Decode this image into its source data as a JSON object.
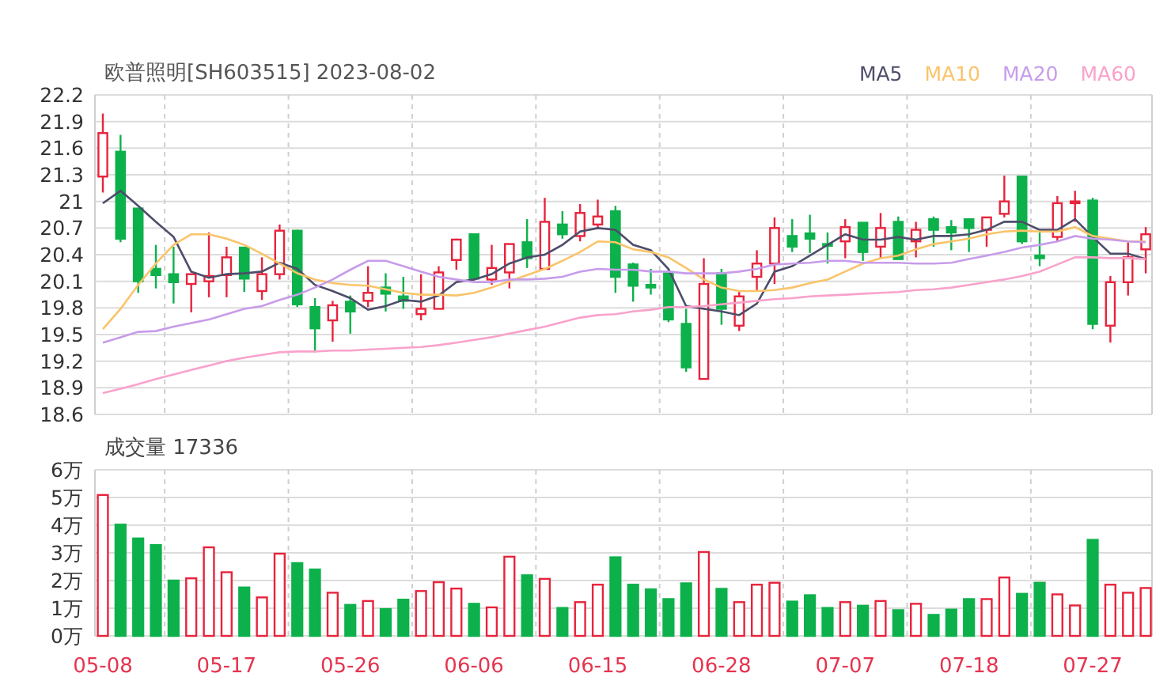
{
  "title": "欧普照明[SH603515] 2023-08-02",
  "price_chart": {
    "chart_data": {
      "type": "candlestick",
      "grid": true,
      "ylim": [
        18.6,
        22.2
      ],
      "yticks": [
        18.6,
        18.9,
        19.2,
        19.5,
        19.8,
        20.1,
        20.4,
        20.7,
        21,
        21.3,
        21.6,
        21.9,
        22.2
      ],
      "categories": [
        null,
        null,
        null,
        null,
        null,
        null,
        null,
        null,
        null,
        null,
        null,
        null,
        null,
        null,
        null,
        null,
        null,
        null,
        null,
        null,
        null,
        null,
        null,
        null,
        null,
        null,
        null,
        null,
        null,
        null,
        null,
        null,
        null,
        null,
        null,
        null,
        null,
        null,
        null,
        null,
        null,
        null,
        null,
        null,
        null,
        null,
        null,
        null,
        null,
        null,
        null,
        null,
        null,
        null,
        null,
        null,
        null,
        null,
        null,
        null
      ],
      "ohlc": [
        [
          21.28,
          21.99,
          21.1,
          21.77
        ],
        [
          21.56,
          21.75,
          20.54,
          20.58
        ],
        [
          20.92,
          20.92,
          19.97,
          20.1
        ],
        [
          20.24,
          20.51,
          20.02,
          20.17
        ],
        [
          20.18,
          20.49,
          19.85,
          20.09
        ],
        [
          20.07,
          20.18,
          19.75,
          20.18
        ],
        [
          20.1,
          20.65,
          19.92,
          20.16
        ],
        [
          20.17,
          20.49,
          19.92,
          20.37
        ],
        [
          20.48,
          20.48,
          19.98,
          20.13
        ],
        [
          19.99,
          20.37,
          19.89,
          20.18
        ],
        [
          20.18,
          20.74,
          20.12,
          20.67
        ],
        [
          20.67,
          20.68,
          19.81,
          19.84
        ],
        [
          19.81,
          19.91,
          19.3,
          19.57
        ],
        [
          19.66,
          19.88,
          19.42,
          19.83
        ],
        [
          19.87,
          19.94,
          19.51,
          19.76
        ],
        [
          19.88,
          20.27,
          19.81,
          19.97
        ],
        [
          20.03,
          20.19,
          19.76,
          19.96
        ],
        [
          19.93,
          20.15,
          19.79,
          19.88
        ],
        [
          19.73,
          20.18,
          19.66,
          19.79
        ],
        [
          19.79,
          20.27,
          19.79,
          20.2
        ],
        [
          20.34,
          20.58,
          20.23,
          20.57
        ],
        [
          20.63,
          20.63,
          20.11,
          20.13
        ],
        [
          20.12,
          20.51,
          20.06,
          20.25
        ],
        [
          20.2,
          20.52,
          20.02,
          20.52
        ],
        [
          20.54,
          20.8,
          20.25,
          20.36
        ],
        [
          20.24,
          21.04,
          20.24,
          20.77
        ],
        [
          20.74,
          20.89,
          20.58,
          20.63
        ],
        [
          20.61,
          20.97,
          20.55,
          20.87
        ],
        [
          20.74,
          21.02,
          20.69,
          20.83
        ],
        [
          20.89,
          20.95,
          19.97,
          20.15
        ],
        [
          20.29,
          20.31,
          19.87,
          20.05
        ],
        [
          20.06,
          20.24,
          19.95,
          20.03
        ],
        [
          20.19,
          20.24,
          19.64,
          19.67
        ],
        [
          19.62,
          19.79,
          19.08,
          19.13
        ],
        [
          19,
          20.36,
          19,
          20.07
        ],
        [
          20.19,
          20.24,
          19.61,
          19.79
        ],
        [
          19.6,
          19.98,
          19.54,
          19.93
        ],
        [
          20.15,
          20.45,
          20,
          20.3
        ],
        [
          20.3,
          20.82,
          20.07,
          20.7
        ],
        [
          20.61,
          20.8,
          20.43,
          20.49
        ],
        [
          20.64,
          20.85,
          20.42,
          20.58
        ],
        [
          20.52,
          20.65,
          20.3,
          20.5
        ],
        [
          20.55,
          20.8,
          20.36,
          20.71
        ],
        [
          20.76,
          20.76,
          20.33,
          20.43
        ],
        [
          20.49,
          20.87,
          20.36,
          20.7
        ],
        [
          20.77,
          20.83,
          20.35,
          20.35
        ],
        [
          20.55,
          20.77,
          20.37,
          20.68
        ],
        [
          20.8,
          20.83,
          20.49,
          20.68
        ],
        [
          20.71,
          20.79,
          20.45,
          20.65
        ],
        [
          20.8,
          20.8,
          20.43,
          20.7
        ],
        [
          20.68,
          20.82,
          20.49,
          20.82
        ],
        [
          20.86,
          21.29,
          20.82,
          21
        ],
        [
          21.28,
          21.28,
          20.52,
          20.55
        ],
        [
          20.39,
          20.65,
          20.27,
          20.36
        ],
        [
          20.6,
          21.06,
          20.55,
          20.98
        ],
        [
          20.98,
          21.12,
          20.77,
          21
        ],
        [
          21.01,
          21.04,
          19.56,
          19.62
        ],
        [
          19.6,
          20.16,
          19.41,
          20.09
        ],
        [
          20.09,
          20.54,
          19.94,
          20.37
        ],
        [
          20.46,
          20.71,
          20.19,
          20.63
        ]
      ]
    }
  },
  "moving_average_chart": {
    "chart_data": {
      "type": "line",
      "ylim": [
        18.6,
        22.2
      ],
      "categories": [
        null,
        null,
        null,
        null,
        null,
        null,
        null,
        null,
        null,
        null,
        null,
        null,
        null,
        null,
        null,
        null,
        null,
        null,
        null,
        null,
        null,
        null,
        null,
        null,
        null,
        null,
        null,
        null,
        null,
        null,
        null,
        null,
        null,
        null,
        null,
        null,
        null,
        null,
        null,
        null,
        null,
        null,
        null,
        null,
        null,
        null,
        null,
        null,
        null,
        null,
        null,
        null,
        null,
        null,
        null,
        null,
        null,
        null,
        null,
        null
      ],
      "series": [
        {
          "name": "MA5",
          "color": "#4d4d6b",
          "values": [
            20.98,
            21.12,
            20.95,
            20.77,
            20.6,
            20.21,
            20.14,
            20.18,
            20.19,
            20.21,
            20.31,
            20.24,
            20.06,
            19.99,
            19.91,
            19.78,
            19.82,
            19.89,
            19.87,
            19.94,
            20.09,
            20.12,
            20.18,
            20.3,
            20.37,
            20.4,
            20.51,
            20.66,
            20.7,
            20.68,
            20.51,
            20.45,
            20.24,
            19.82,
            19.79,
            19.76,
            19.72,
            19.85,
            20.21,
            20.27,
            20.39,
            20.51,
            20.63,
            20.57,
            20.57,
            20.6,
            20.57,
            20.61,
            20.61,
            20.63,
            20.68,
            20.77,
            20.77,
            20.68,
            20.68,
            20.8,
            20.6,
            20.41,
            20.41,
            20.35
          ]
        },
        {
          "name": "MA10",
          "color": "#f9c46a",
          "values": [
            19.56,
            19.79,
            20.06,
            20.3,
            20.51,
            20.63,
            20.63,
            20.58,
            20.51,
            20.41,
            20.3,
            20.19,
            20.12,
            20.08,
            20.06,
            20.05,
            20.01,
            19.97,
            19.95,
            19.95,
            19.94,
            19.97,
            20.03,
            20.1,
            20.17,
            20.24,
            20.33,
            20.43,
            20.55,
            20.54,
            20.46,
            20.43,
            20.37,
            20.25,
            20.12,
            20.03,
            19.99,
            19.99,
            20,
            20.03,
            20.08,
            20.12,
            20.21,
            20.3,
            20.36,
            20.39,
            20.46,
            20.52,
            20.55,
            20.58,
            20.63,
            20.66,
            20.67,
            20.66,
            20.66,
            20.71,
            20.61,
            20.58,
            20.55,
            20.55
          ]
        },
        {
          "name": "MA20",
          "color": "#c79ceb",
          "values": [
            19.41,
            19.47,
            19.53,
            19.54,
            19.59,
            19.63,
            19.67,
            19.73,
            19.79,
            19.82,
            19.89,
            19.95,
            20.03,
            20.12,
            20.23,
            20.33,
            20.33,
            20.27,
            20.21,
            20.15,
            20.12,
            20.09,
            20.09,
            20.12,
            20.12,
            20.13,
            20.15,
            20.21,
            20.24,
            20.23,
            20.23,
            20.21,
            20.21,
            20.19,
            20.19,
            20.19,
            20.21,
            20.24,
            20.29,
            20.3,
            20.31,
            20.33,
            20.33,
            20.31,
            20.31,
            20.31,
            20.3,
            20.3,
            20.31,
            20.35,
            20.39,
            20.43,
            20.48,
            20.51,
            20.55,
            20.61,
            20.58,
            20.57,
            20.55,
            20.54
          ]
        },
        {
          "name": "MA60",
          "color": "#f9a2cb",
          "values": [
            18.84,
            18.89,
            18.94,
            19,
            19.05,
            19.1,
            19.15,
            19.2,
            19.24,
            19.27,
            19.3,
            19.31,
            19.31,
            19.32,
            19.32,
            19.33,
            19.34,
            19.35,
            19.36,
            19.38,
            19.41,
            19.44,
            19.47,
            19.51,
            19.55,
            19.59,
            19.64,
            19.69,
            19.72,
            19.73,
            19.76,
            19.78,
            19.81,
            19.81,
            19.82,
            19.84,
            19.86,
            19.88,
            19.9,
            19.91,
            19.93,
            19.94,
            19.95,
            19.96,
            19.97,
            19.98,
            20,
            20.01,
            20.03,
            20.06,
            20.09,
            20.12,
            20.16,
            20.21,
            20.29,
            20.37,
            20.37,
            20.36,
            20.36,
            20.35
          ]
        }
      ]
    }
  },
  "volume_chart": {
    "label": "成交量 17336",
    "chart_data": {
      "type": "bar",
      "grid": true,
      "ylim": [
        0,
        6
      ],
      "yticks": [
        {
          "value": 0,
          "label": "0万"
        },
        {
          "value": 1,
          "label": "1万"
        },
        {
          "value": 2,
          "label": "2万"
        },
        {
          "value": 3,
          "label": "3万"
        },
        {
          "value": 4,
          "label": "4万"
        },
        {
          "value": 5,
          "label": "5万"
        },
        {
          "value": 6,
          "label": "6万"
        }
      ],
      "categories": [
        "05-08",
        null,
        null,
        null,
        null,
        null,
        null,
        "05-17",
        null,
        null,
        null,
        null,
        null,
        null,
        "05-26",
        null,
        null,
        null,
        null,
        null,
        null,
        "06-06",
        null,
        null,
        null,
        null,
        null,
        null,
        "06-15",
        null,
        null,
        null,
        null,
        null,
        null,
        "06-28",
        null,
        null,
        null,
        null,
        null,
        null,
        "07-07",
        null,
        null,
        null,
        null,
        null,
        null,
        "07-18",
        null,
        null,
        null,
        null,
        null,
        null,
        "07-27",
        null,
        null,
        null
      ],
      "values": [
        5.09,
        4.02,
        3.52,
        3.28,
        2,
        2.08,
        3.2,
        2.3,
        1.75,
        1.39,
        2.97,
        2.63,
        2.4,
        1.56,
        1.12,
        1.26,
        0.97,
        1.31,
        1.62,
        1.94,
        1.71,
        1.16,
        1.03,
        2.86,
        2.19,
        2.06,
        1.01,
        1.22,
        1.85,
        2.84,
        1.85,
        1.68,
        1.33,
        1.9,
        3.03,
        1.7,
        1.22,
        1.85,
        1.92,
        1.24,
        1.47,
        1.01,
        1.22,
        1.09,
        1.26,
        0.93,
        1.16,
        0.76,
        0.95,
        1.33,
        1.33,
        2.11,
        1.52,
        1.92,
        1.5,
        1.1,
        3.47,
        1.85,
        1.56,
        1.73
      ]
    }
  }
}
